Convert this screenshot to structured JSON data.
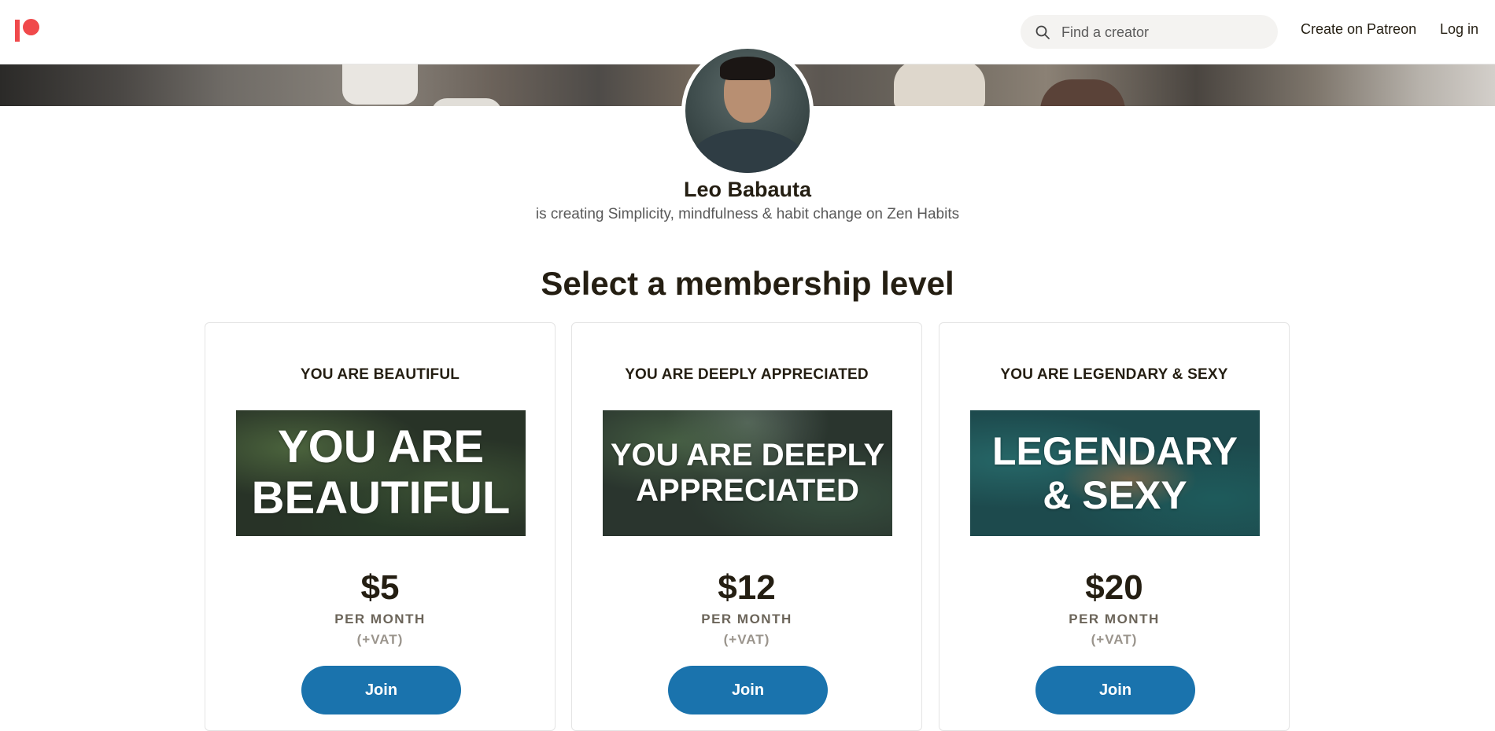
{
  "brand": {
    "logo_icon": "patreon-logo-icon",
    "color": "#f0494b"
  },
  "header": {
    "search": {
      "icon": "search-icon",
      "placeholder": "Find a creator",
      "value": ""
    },
    "create_label": "Create on Patreon",
    "login_label": "Log in"
  },
  "creator": {
    "name": "Leo Babauta",
    "tagline": "is creating Simplicity, mindfulness & habit change on Zen Habits"
  },
  "membership": {
    "title": "Select a membership level",
    "accent_color": "#1a73ad",
    "tiers": [
      {
        "title": "YOU ARE BEAUTIFUL",
        "image_text": [
          "YOU ARE",
          "BEAUTIFUL"
        ],
        "price": "$5",
        "period": "PER MONTH",
        "vat": "(+VAT)",
        "join_label": "Join"
      },
      {
        "title": "YOU ARE DEEPLY APPRECIATED",
        "image_text": [
          "YOU ARE DEEPLY",
          "APPRECIATED"
        ],
        "price": "$12",
        "period": "PER MONTH",
        "vat": "(+VAT)",
        "join_label": "Join"
      },
      {
        "title": "YOU ARE LEGENDARY & SEXY",
        "image_text": [
          "LEGENDARY",
          "& SEXY"
        ],
        "price": "$20",
        "period": "PER MONTH",
        "vat": "(+VAT)",
        "join_label": "Join"
      }
    ]
  }
}
